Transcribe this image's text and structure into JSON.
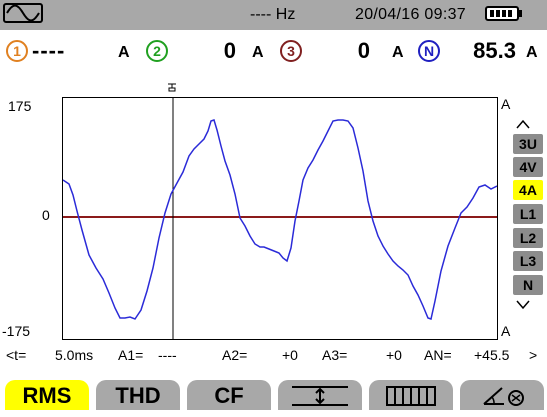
{
  "status": {
    "frequency": "---- Hz",
    "datetime": "20/04/16  09:37"
  },
  "channels": [
    {
      "id": "1",
      "value": "----",
      "unit": "A",
      "color": "#e08020"
    },
    {
      "id": "2",
      "value": "0",
      "unit": "A",
      "color": "#20a020"
    },
    {
      "id": "3",
      "value": "0",
      "unit": "A",
      "color": "#802020"
    },
    {
      "id": "N",
      "value": "85.3",
      "unit": "A",
      "color": "#2020c0"
    }
  ],
  "plot": {
    "y_max": "175",
    "y_zero": "0",
    "y_min": "-175",
    "unit_top": "A",
    "unit_bottom": "A",
    "trace_color": "#2b2bd8",
    "zero_line_color": "#8b1a1a"
  },
  "side_selector": [
    "3U",
    "4V",
    "4A",
    "L1",
    "L2",
    "L3",
    "N"
  ],
  "side_selector_active": "4A",
  "readout": {
    "t_label": "<t=",
    "t_value": "5.0ms",
    "a1_label": "A1=",
    "a1_value": "----",
    "a2_label": "A2=",
    "a2_value": "+0",
    "a3_label": "A3=",
    "a3_value": "+0",
    "an_label": "AN=",
    "an_value": "+45.5",
    "next": ">"
  },
  "function_keys": {
    "rms": "RMS",
    "thd": "THD",
    "cf": "CF"
  }
}
